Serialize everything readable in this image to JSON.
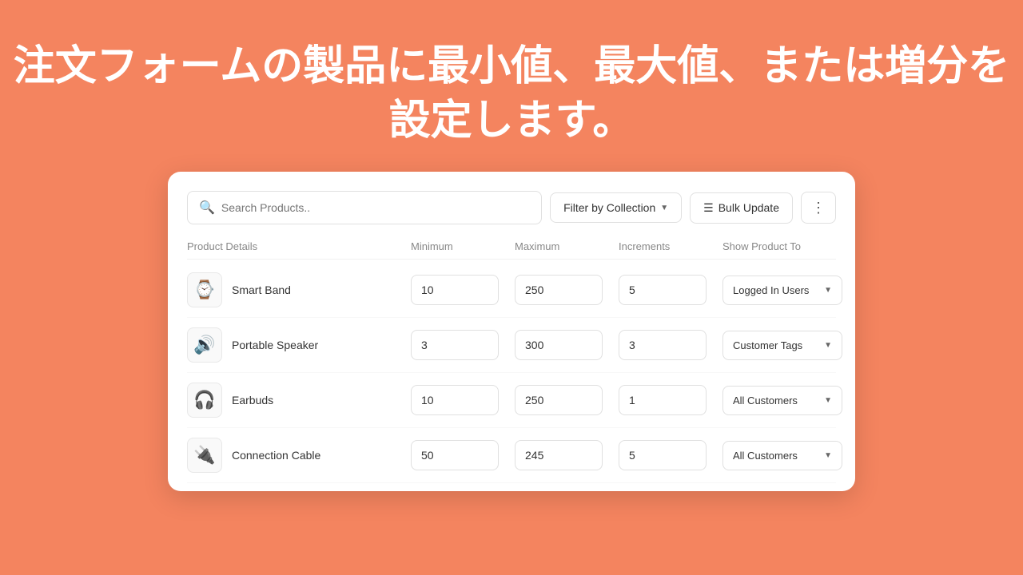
{
  "hero": {
    "text": "注文フォームの製品に最小値、最大値、または増分を設定します。"
  },
  "toolbar": {
    "search_placeholder": "Search Products..",
    "filter_label": "Filter by Collection",
    "bulk_label": "Bulk Update",
    "more_icon": "⋮"
  },
  "table": {
    "headers": {
      "product": "Product Details",
      "minimum": "Minimum",
      "maximum": "Maximum",
      "increments": "Increments",
      "show_to": "Show Product To"
    },
    "rows": [
      {
        "id": "smart-band",
        "name": "Smart Band",
        "emoji": "⌚",
        "min": "10",
        "max": "250",
        "increment": "5",
        "show_to": "Logged In Users"
      },
      {
        "id": "portable-speaker",
        "name": "Portable Speaker",
        "emoji": "🔊",
        "min": "3",
        "max": "300",
        "increment": "3",
        "show_to": "Customer Tags"
      },
      {
        "id": "earbuds",
        "name": "Earbuds",
        "emoji": "🎧",
        "min": "10",
        "max": "250",
        "increment": "1",
        "show_to": "All Customers"
      },
      {
        "id": "connection-cable",
        "name": "Connection Cable",
        "emoji": "🔌",
        "min": "50",
        "max": "245",
        "increment": "5",
        "show_to": "All Customers"
      }
    ]
  }
}
